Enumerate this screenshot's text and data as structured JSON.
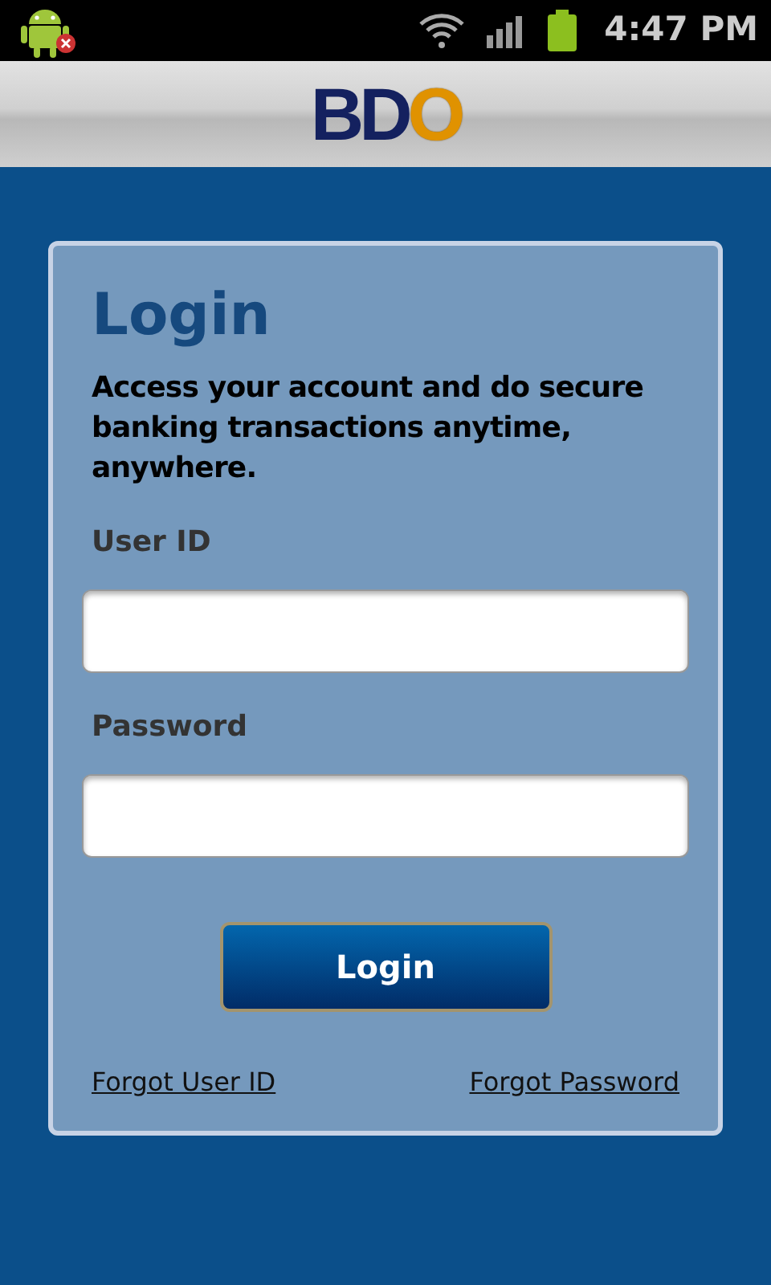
{
  "status_bar": {
    "time": "4:47 PM"
  },
  "logo": {
    "primary": "BD",
    "accent": "O"
  },
  "login": {
    "title": "Login",
    "description": "Access your account and do secure banking transactions anytime, anywhere.",
    "fields": [
      {
        "label": "User ID"
      },
      {
        "label": "Password"
      }
    ],
    "button": "Login",
    "links": [
      "Forgot User ID",
      "Forgot Password"
    ]
  }
}
